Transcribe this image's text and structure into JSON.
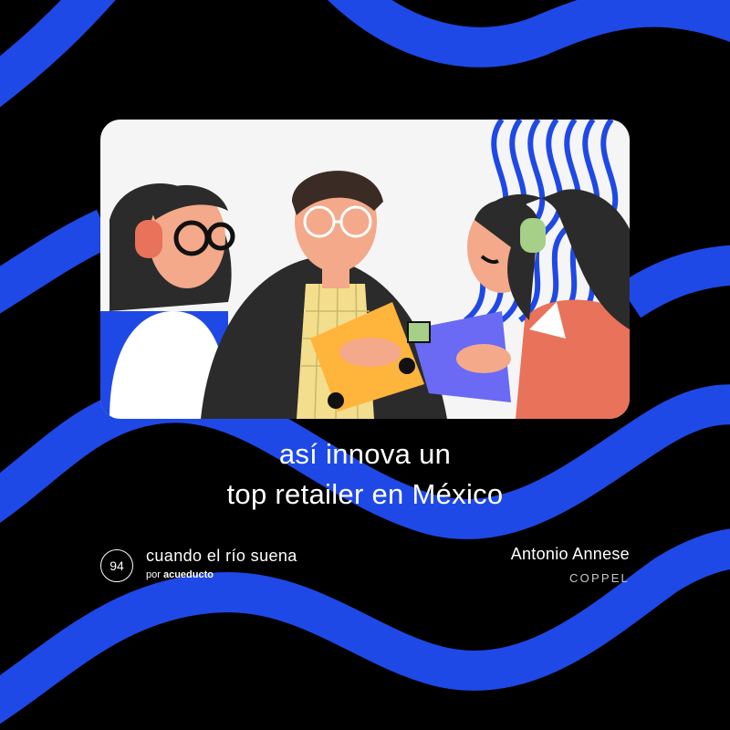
{
  "headline": {
    "line1": "así innova un",
    "line2": "top retailer en México"
  },
  "podcast": {
    "episode_number": "94",
    "name": "cuando el río suena",
    "by_prefix": "por",
    "by_brand": "acueducto"
  },
  "guest": {
    "name": "Antonio Annese",
    "company": "COPPEL"
  },
  "colors": {
    "background": "#000000",
    "accent_blue": "#1f49e6",
    "text": "#ffffff"
  },
  "icons": [
    "podcast-episode-badge",
    "headphones-icon",
    "glasses-icon",
    "card-icon"
  ]
}
